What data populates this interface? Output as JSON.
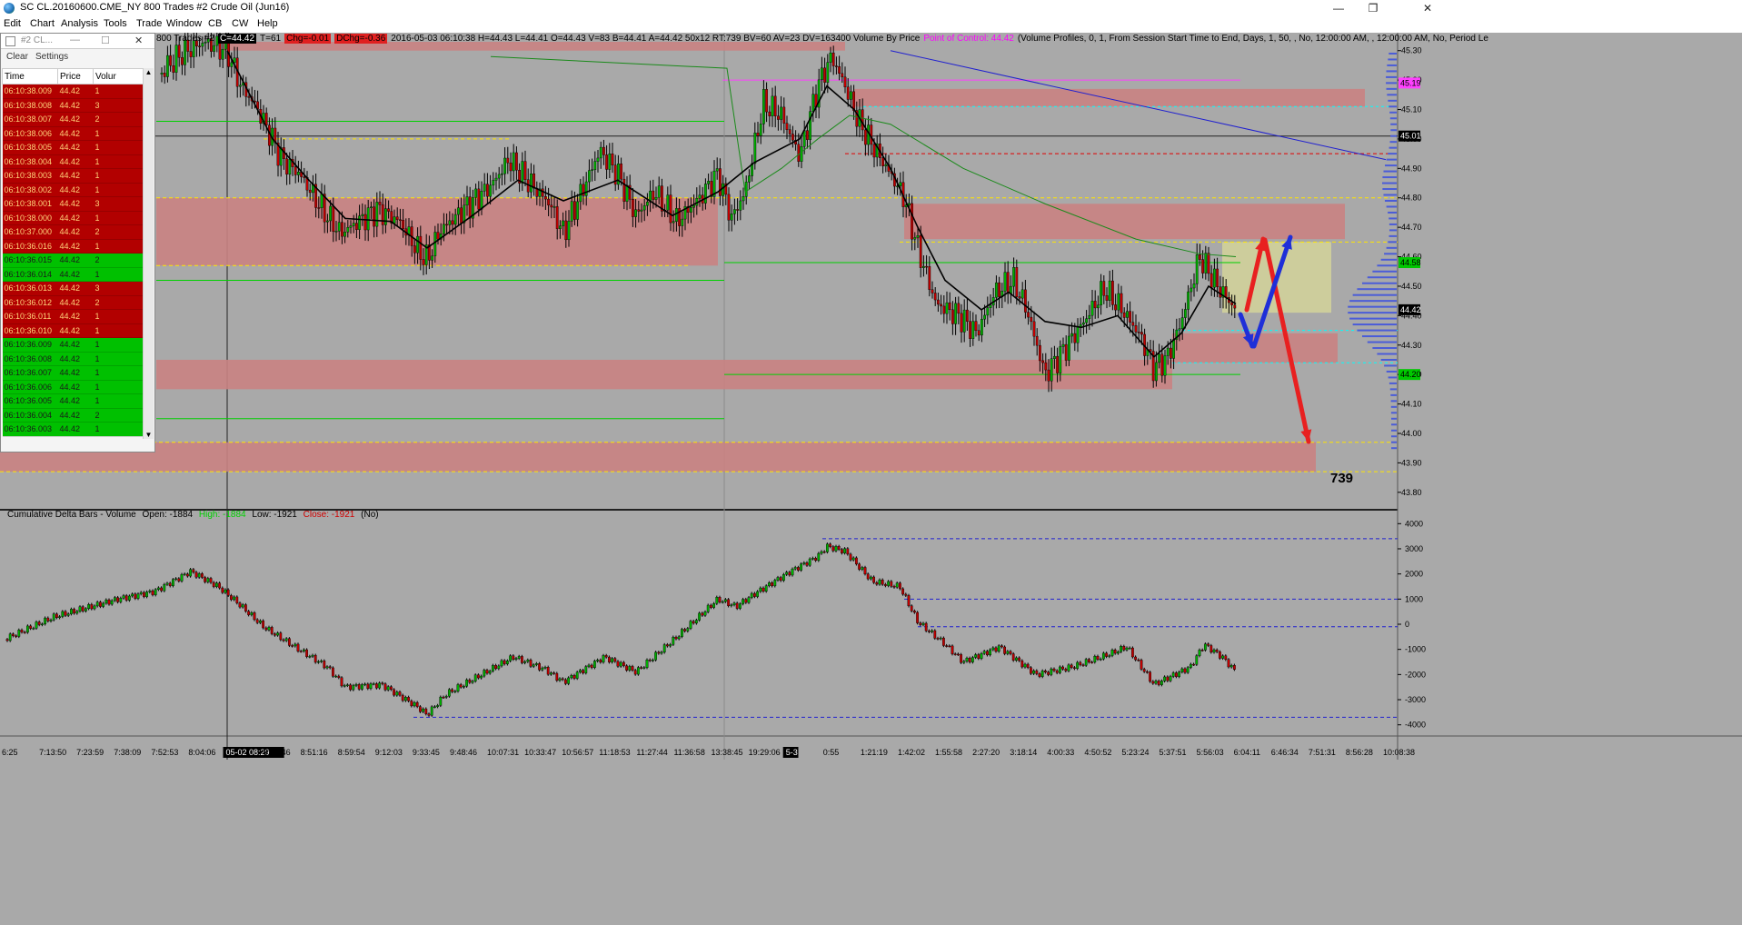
{
  "window": {
    "title": "SC CL.20160600.CME_NY  800 Trades  #2  Crude Oil (Jun16)",
    "minimize": "—",
    "maximize": "❐",
    "close": "✕"
  },
  "menu": [
    "Edit",
    "Chart",
    "Analysis",
    "Tools",
    "Trade",
    "Window",
    "CB",
    "CW",
    "Help"
  ],
  "time_sales": {
    "title": "#2 CL...",
    "toolbar": {
      "clear": "Clear",
      "settings": "Settings"
    },
    "columns": [
      "Time",
      "Price",
      "Volur"
    ],
    "rows": [
      {
        "time": "06:10:38.009",
        "price": "44.42",
        "vol": "1",
        "side": "sell"
      },
      {
        "time": "06:10:38.008",
        "price": "44.42",
        "vol": "3",
        "side": "sell"
      },
      {
        "time": "06:10:38.007",
        "price": "44.42",
        "vol": "2",
        "side": "sell"
      },
      {
        "time": "06:10:38.006",
        "price": "44.42",
        "vol": "1",
        "side": "sell"
      },
      {
        "time": "06:10:38.005",
        "price": "44.42",
        "vol": "1",
        "side": "sell"
      },
      {
        "time": "06:10:38.004",
        "price": "44.42",
        "vol": "1",
        "side": "sell"
      },
      {
        "time": "06:10:38.003",
        "price": "44.42",
        "vol": "1",
        "side": "sell"
      },
      {
        "time": "06:10:38.002",
        "price": "44.42",
        "vol": "1",
        "side": "sell"
      },
      {
        "time": "06:10:38.001",
        "price": "44.42",
        "vol": "3",
        "side": "sell"
      },
      {
        "time": "06:10:38.000",
        "price": "44.42",
        "vol": "1",
        "side": "sell"
      },
      {
        "time": "06:10:37.000",
        "price": "44.42",
        "vol": "2",
        "side": "sell"
      },
      {
        "time": "06:10:36.016",
        "price": "44.42",
        "vol": "1",
        "side": "sell"
      },
      {
        "time": "06:10:36.015",
        "price": "44.42",
        "vol": "2",
        "side": "buy"
      },
      {
        "time": "06:10:36.014",
        "price": "44.42",
        "vol": "1",
        "side": "buy"
      },
      {
        "time": "06:10:36.013",
        "price": "44.42",
        "vol": "3",
        "side": "sell"
      },
      {
        "time": "06:10:36.012",
        "price": "44.42",
        "vol": "2",
        "side": "sell"
      },
      {
        "time": "06:10:36.011",
        "price": "44.42",
        "vol": "1",
        "side": "sell"
      },
      {
        "time": "06:10:36.010",
        "price": "44.42",
        "vol": "1",
        "side": "sell"
      },
      {
        "time": "06:10:36.009",
        "price": "44.42",
        "vol": "1",
        "side": "buy"
      },
      {
        "time": "06:10:36.008",
        "price": "44.42",
        "vol": "1",
        "side": "buy"
      },
      {
        "time": "06:10:36.007",
        "price": "44.42",
        "vol": "1",
        "side": "buy"
      },
      {
        "time": "06:10:36.006",
        "price": "44.42",
        "vol": "1",
        "side": "buy"
      },
      {
        "time": "06:10:36.005",
        "price": "44.42",
        "vol": "1",
        "side": "buy"
      },
      {
        "time": "06:10:36.004",
        "price": "44.42",
        "vol": "2",
        "side": "buy"
      },
      {
        "time": "06:10:36.003",
        "price": "44.42",
        "vol": "1",
        "side": "buy"
      }
    ]
  },
  "info_bar": {
    "prefix": "800 Trades  #2",
    "close": "C=44.42",
    "trades": "T=61",
    "chg": "Chg=-0.01",
    "dchg": "DChg=-0.36",
    "ohlc": "2016-05-03 06:10:38 H=44.43 L=44.41 O=44.43 V=83 B=44.41 A=44.42 50x12 RT:739 BV=60 AV=23 DV=163400 Volume By Price",
    "poc": "Point of Control: 44.42",
    "vp_settings": "(Volume Profiles, 0, 1, From Session Start Time to End, Days, 1, 50, , No, 12:00:00 AM, , 12:00:00 AM, No, Period Le"
  },
  "price_axis": [
    "45.30",
    "45.20",
    "45.10",
    "45.00",
    "44.90",
    "44.80",
    "44.70",
    "44.60",
    "44.50",
    "44.40",
    "44.30",
    "44.20",
    "44.10",
    "44.00",
    "43.90",
    "43.80"
  ],
  "price_markers": [
    {
      "text": "45.19",
      "value": 45.19,
      "color": "#ff40ff"
    },
    {
      "text": "45.01",
      "value": 45.01,
      "color": "#000000"
    },
    {
      "text": "44.58",
      "value": 44.58,
      "color": "#00c800"
    },
    {
      "text": "44.42",
      "value": 44.42,
      "color": "#000000"
    },
    {
      "text": "44.20",
      "value": 44.2,
      "color": "#00c800"
    }
  ],
  "annotation_739": "739",
  "delta_panel": {
    "name": "Cumulative Delta Bars - Volume",
    "open": "Open: -1884",
    "high": "High: -1884",
    "low": "Low: -1921",
    "close": "Close: -1921",
    "flag": "(No)",
    "axis": [
      "4000",
      "3000",
      "2000",
      "1000",
      "0",
      "-1000",
      "-2000",
      "-3000",
      "-4000"
    ]
  },
  "time_axis": [
    "6:25",
    "7:13:50",
    "7:23:59",
    "7:38:09",
    "7:52:53",
    "8:04:06",
    "05-02  08:29",
    "8:44:46",
    "8:51:16",
    "8:59:54",
    "9:12:03",
    "9:33:45",
    "9:48:46",
    "10:07:31",
    "10:33:47",
    "10:56:57",
    "11:18:53",
    "11:27:44",
    "11:36:58",
    "13:38:45",
    "19:29:06",
    "5-3",
    "0:55",
    "1:21:19",
    "1:42:02",
    "1:55:58",
    "2:27:20",
    "3:18:14",
    "4:00:33",
    "4:50:52",
    "5:23:24",
    "5:37:51",
    "5:56:03",
    "6:04:11",
    "6:46:34",
    "7:51:31",
    "8:56:28",
    "10:08:38"
  ],
  "chart_data": {
    "type": "candlestick",
    "price_range": [
      43.75,
      45.33
    ],
    "path": [
      [
        175,
        45.22
      ],
      [
        200,
        45.29
      ],
      [
        225,
        45.33
      ],
      [
        250,
        45.3
      ],
      [
        265,
        45.18
      ],
      [
        280,
        45.12
      ],
      [
        295,
        45.03
      ],
      [
        310,
        44.93
      ],
      [
        330,
        44.88
      ],
      [
        355,
        44.76
      ],
      [
        375,
        44.68
      ],
      [
        395,
        44.72
      ],
      [
        415,
        44.76
      ],
      [
        440,
        44.72
      ],
      [
        460,
        44.62
      ],
      [
        470,
        44.59
      ],
      [
        485,
        44.69
      ],
      [
        510,
        44.76
      ],
      [
        540,
        44.84
      ],
      [
        560,
        44.93
      ],
      [
        580,
        44.86
      ],
      [
        605,
        44.78
      ],
      [
        620,
        44.68
      ],
      [
        640,
        44.82
      ],
      [
        660,
        44.96
      ],
      [
        680,
        44.88
      ],
      [
        700,
        44.74
      ],
      [
        720,
        44.82
      ],
      [
        745,
        44.72
      ],
      [
        770,
        44.8
      ],
      [
        790,
        44.88
      ],
      [
        805,
        44.73
      ],
      [
        820,
        44.82
      ],
      [
        840,
        45.12
      ],
      [
        860,
        45.08
      ],
      [
        880,
        44.94
      ],
      [
        900,
        45.18
      ],
      [
        915,
        45.28
      ],
      [
        930,
        45.18
      ],
      [
        945,
        45.06
      ],
      [
        960,
        44.98
      ],
      [
        980,
        44.88
      ],
      [
        995,
        44.8
      ],
      [
        1010,
        44.63
      ],
      [
        1030,
        44.44
      ],
      [
        1055,
        44.4
      ],
      [
        1075,
        44.34
      ],
      [
        1095,
        44.48
      ],
      [
        1115,
        44.52
      ],
      [
        1130,
        44.42
      ],
      [
        1150,
        44.2
      ],
      [
        1170,
        44.28
      ],
      [
        1195,
        44.39
      ],
      [
        1215,
        44.49
      ],
      [
        1235,
        44.42
      ],
      [
        1255,
        44.33
      ],
      [
        1270,
        44.22
      ],
      [
        1285,
        44.26
      ],
      [
        1300,
        44.38
      ],
      [
        1320,
        44.6
      ],
      [
        1340,
        44.5
      ],
      [
        1360,
        44.42
      ]
    ],
    "sma_black": [
      [
        250,
        45.3
      ],
      [
        300,
        45.0
      ],
      [
        340,
        44.86
      ],
      [
        380,
        44.73
      ],
      [
        430,
        44.72
      ],
      [
        470,
        44.63
      ],
      [
        520,
        44.74
      ],
      [
        570,
        44.86
      ],
      [
        620,
        44.79
      ],
      [
        680,
        44.86
      ],
      [
        740,
        44.74
      ],
      [
        790,
        44.82
      ],
      [
        830,
        44.92
      ],
      [
        880,
        45.0
      ],
      [
        910,
        45.18
      ],
      [
        940,
        45.1
      ],
      [
        980,
        44.9
      ],
      [
        1010,
        44.7
      ],
      [
        1040,
        44.52
      ],
      [
        1080,
        44.42
      ],
      [
        1110,
        44.48
      ],
      [
        1150,
        44.38
      ],
      [
        1190,
        44.36
      ],
      [
        1230,
        44.4
      ],
      [
        1270,
        44.26
      ],
      [
        1300,
        44.34
      ],
      [
        1330,
        44.5
      ],
      [
        1360,
        44.44
      ]
    ],
    "sma_green": [
      [
        540,
        45.28
      ],
      [
        800,
        45.24
      ],
      [
        820,
        44.82
      ],
      [
        860,
        44.9
      ],
      [
        900,
        45.0
      ],
      [
        935,
        45.08
      ],
      [
        980,
        45.05
      ],
      [
        1060,
        44.9
      ],
      [
        1150,
        44.78
      ],
      [
        1250,
        44.66
      ],
      [
        1320,
        44.61
      ],
      [
        1360,
        44.6
      ]
    ],
    "delta_range": [
      -4300,
      4300
    ],
    "delta_path": [
      [
        5,
        -600
      ],
      [
        60,
        300
      ],
      [
        130,
        1000
      ],
      [
        170,
        1300
      ],
      [
        210,
        2100
      ],
      [
        240,
        1500
      ],
      [
        260,
        900
      ],
      [
        290,
        -100
      ],
      [
        320,
        -800
      ],
      [
        360,
        -1700
      ],
      [
        380,
        -2500
      ],
      [
        420,
        -2400
      ],
      [
        460,
        -3300
      ],
      [
        470,
        -3600
      ],
      [
        490,
        -2800
      ],
      [
        530,
        -2000
      ],
      [
        565,
        -1300
      ],
      [
        600,
        -1800
      ],
      [
        620,
        -2300
      ],
      [
        665,
        -1300
      ],
      [
        700,
        -1900
      ],
      [
        745,
        -500
      ],
      [
        790,
        1000
      ],
      [
        810,
        700
      ],
      [
        830,
        1200
      ],
      [
        870,
        2100
      ],
      [
        900,
        2700
      ],
      [
        910,
        3100
      ],
      [
        930,
        2900
      ],
      [
        960,
        1700
      ],
      [
        990,
        1500
      ],
      [
        1010,
        100
      ],
      [
        1040,
        -800
      ],
      [
        1060,
        -1500
      ],
      [
        1100,
        -900
      ],
      [
        1140,
        -2000
      ],
      [
        1180,
        -1700
      ],
      [
        1220,
        -1200
      ],
      [
        1240,
        -900
      ],
      [
        1270,
        -2400
      ],
      [
        1310,
        -1700
      ],
      [
        1325,
        -800
      ],
      [
        1345,
        -1300
      ],
      [
        1360,
        -1900
      ]
    ]
  },
  "colors": {
    "bg": "#a9a9a9",
    "zone": "#c98282",
    "zone_yellow": "#d4d49a",
    "sell_row": "#b20000",
    "buy_row": "#00c000",
    "poc": "#ff00ff"
  }
}
